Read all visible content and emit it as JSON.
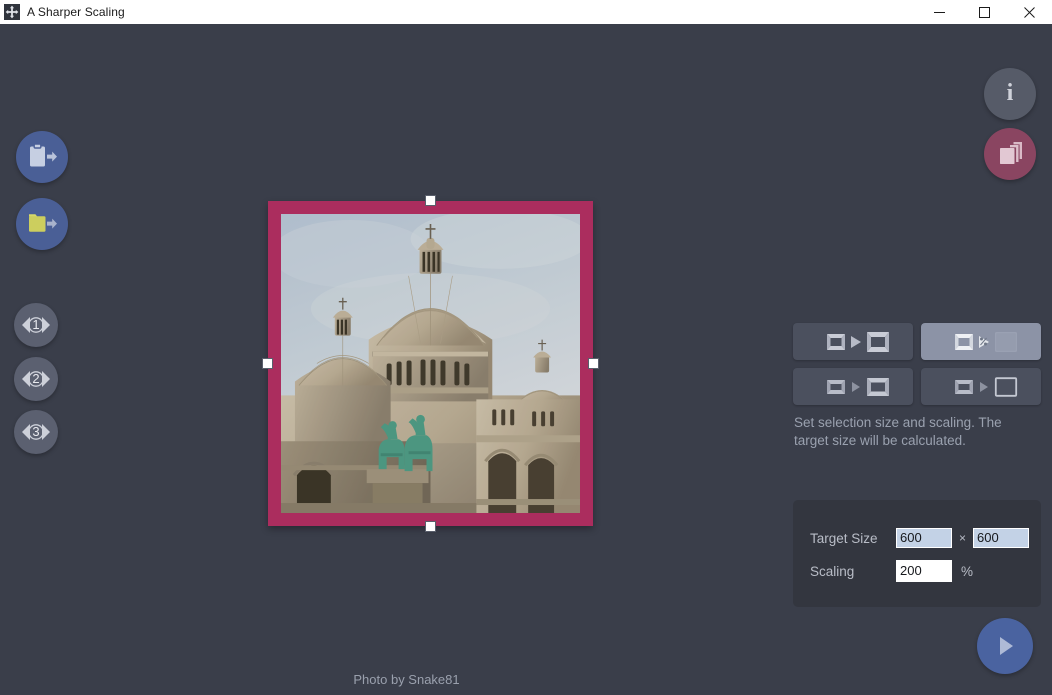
{
  "window": {
    "title": "A Sharper Scaling",
    "icon": "move-arrows-icon",
    "controls": {
      "minimize_label": "Minimize",
      "maximize_label": "Maximize",
      "close_label": "Close"
    }
  },
  "toolbar_left": {
    "paste_label": "Paste from clipboard",
    "open_label": "Open file",
    "memory_slots": [
      {
        "label": "1",
        "name": "memory-slot-1"
      },
      {
        "label": "2",
        "name": "memory-slot-2"
      },
      {
        "label": "3",
        "name": "memory-slot-3"
      }
    ]
  },
  "toolbar_right": {
    "info_label": "i",
    "info_title": "About",
    "layers_title": "Compare / layers"
  },
  "canvas": {
    "credit": "Photo by Snake81",
    "selection": {
      "border_color": "#ab2d5e",
      "handles": [
        "top",
        "right",
        "bottom",
        "left"
      ]
    },
    "background_color": "#3a3e4a"
  },
  "panel": {
    "modes": [
      {
        "name": "mode-size-to-size",
        "selected": false,
        "title": "Set source size and target size"
      },
      {
        "name": "mode-size-to-percent",
        "selected": true,
        "title": "Set selection size and scaling"
      },
      {
        "name": "mode-fit-width",
        "selected": false,
        "title": "Set target width"
      },
      {
        "name": "mode-fit-height",
        "selected": false,
        "title": "Set target height"
      }
    ],
    "hint": "Set selection size and scaling. The target size will be calculated.",
    "size": {
      "target_label": "Target Size",
      "target_width": "600",
      "target_height": "600",
      "times": "×",
      "scaling_label": "Scaling",
      "scaling_value": "200",
      "percent": "%"
    },
    "run_label": "Run scaling"
  },
  "colors": {
    "background": "#3a3e4a",
    "panel": "#33363f",
    "accent_blue": "#4a5f96",
    "accent_maroon": "#8a4561",
    "selection_magenta": "#ab2d5e",
    "mode_selected": "#8c93a6",
    "input_calculated": "#c3d2e6"
  }
}
